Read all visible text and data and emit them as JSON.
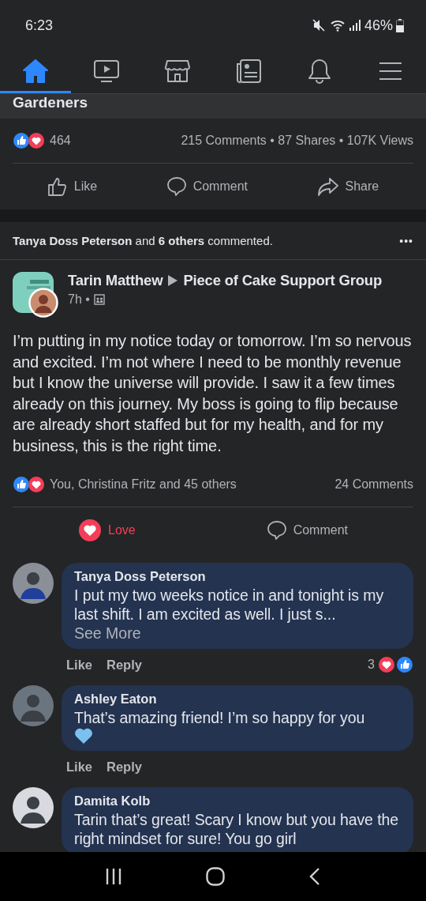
{
  "status_bar": {
    "time": "6:23",
    "battery": "46%"
  },
  "tabs": [
    {
      "kind": "home",
      "selected": true
    },
    {
      "kind": "video",
      "selected": false
    },
    {
      "kind": "market",
      "selected": false
    },
    {
      "kind": "news",
      "selected": false
    },
    {
      "kind": "bell",
      "selected": false
    },
    {
      "kind": "menu",
      "selected": false
    }
  ],
  "previous_post": {
    "title": "Gardeners",
    "reaction_count": "464",
    "stats": "215 Comments • 87 Shares • 107K Views",
    "actions": [
      {
        "kind": "like",
        "label": "Like"
      },
      {
        "kind": "comment",
        "label": "Comment"
      },
      {
        "kind": "share",
        "label": "Share"
      }
    ]
  },
  "activity": {
    "text": "**Tanya Doss Peterson** and **6 others** commented.",
    "more": "•••"
  },
  "post": {
    "author": "Tarin Matthew",
    "group": "Piece of Cake Support Group",
    "time": "7h •",
    "text": "I’m putting in my notice today or tomorrow. I’m so nervous and excited. I’m not where I need to be monthly revenue but I know the universe will provide. I saw it a few times already on this journey. My boss is going to flip because are already short staffed but for my health, and for my business, this is the right time.",
    "reactions": "You, Christina Fritz and 45 others",
    "comments": "24 Comments",
    "actions": [
      {
        "kind": "love",
        "label": "Love",
        "selected": true
      },
      {
        "kind": "comment",
        "label": "Comment",
        "selected": false
      }
    ]
  },
  "comments": [
    {
      "name": "Tanya Doss Peterson",
      "text": "I put my two weeks notice in and tonight is my last shift. I am excited as well.  I just s...",
      "see_more": "See More",
      "heart": false,
      "actions": [
        "Like",
        "Reply"
      ],
      "reaction_count": "3"
    },
    {
      "name": "Ashley Eaton",
      "text": "That’s amazing friend! I’m so happy for you",
      "heart": true,
      "actions": [
        "Like",
        "Reply"
      ]
    },
    {
      "name": "Damita Kolb",
      "text": "Tarin that’s great!  Scary I know but you have the right mindset for sure!  You go girl",
      "heart": false
    }
  ]
}
